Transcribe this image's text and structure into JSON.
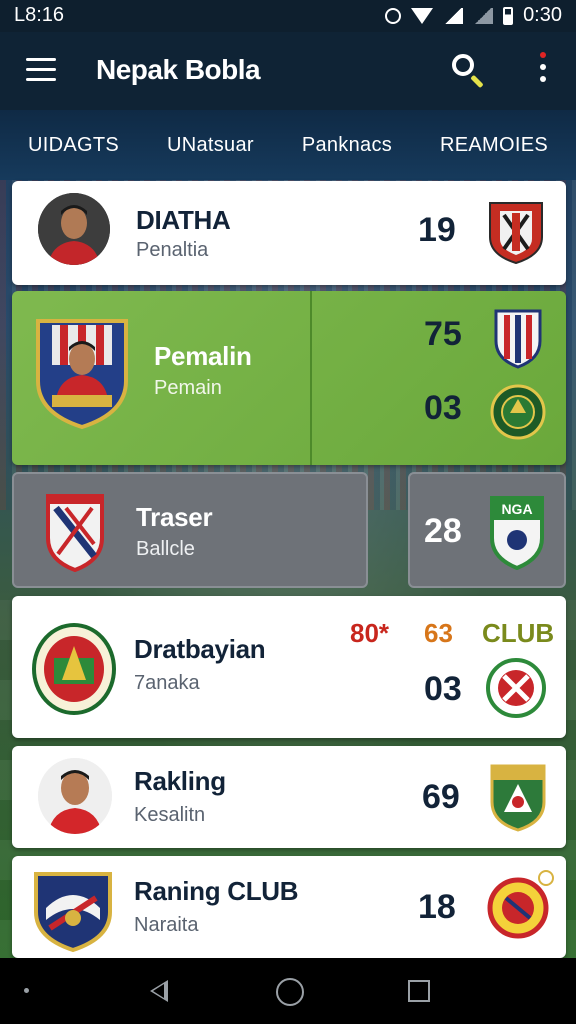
{
  "status_bar": {
    "time": "L8:16",
    "clock_right": "0:30",
    "icons": [
      "alarm-icon",
      "wifi-icon",
      "signal-icon",
      "battery-icon"
    ]
  },
  "app_bar": {
    "title": "Nepak Bobla"
  },
  "tabs": [
    "UIDAGTS",
    "UNatsuar",
    "Panknacs",
    "REAMOIES"
  ],
  "rows": [
    {
      "name": "DIATHA",
      "sub": "Penaltia",
      "value": "19"
    },
    {
      "name": "Pemalin",
      "sub": "Pemain",
      "values": [
        "75",
        "03"
      ]
    },
    {
      "name": "Traser",
      "sub": "Ballcle",
      "value": "28",
      "crest_text": "NGA"
    },
    {
      "name": "Dratbayian",
      "sub": "7anaka",
      "top_a": "80*",
      "top_b": "63",
      "top_c": "CLUB",
      "value": "03"
    },
    {
      "name": "Rakling",
      "sub": "Kesalitn",
      "value": "69"
    },
    {
      "name": "Raning CLUB",
      "sub": "Naraita",
      "value": "18"
    }
  ],
  "colors": {
    "appbar": "#0f2335",
    "green_card": "#6aa83b",
    "grey_card": "#6e7278",
    "text_dark": "#122338",
    "score_red": "#c8261d",
    "score_orange": "#d7761a",
    "club_olive": "#7a8a1c"
  }
}
